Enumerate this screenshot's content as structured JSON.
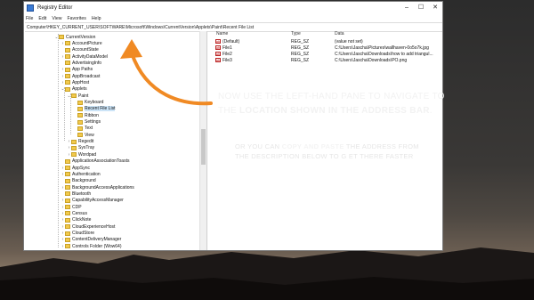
{
  "window": {
    "title": "Registry Editor",
    "controls": [
      "–",
      "☐",
      "✕"
    ]
  },
  "menu": [
    "File",
    "Edit",
    "View",
    "Favorites",
    "Help"
  ],
  "address": "Computer\\HKEY_CURRENT_USER\\SOFTWARE\\Microsoft\\Windows\\CurrentVersion\\Applets\\Paint\\Recent File List",
  "tree": [
    {
      "label": "CurrentVersion",
      "exp": "⌄"
    },
    {
      "label": "AccountPicture",
      "exp": "›"
    },
    {
      "label": "AccountState",
      "exp": ""
    },
    {
      "label": "ActivityDataModel",
      "exp": "›"
    },
    {
      "label": "AdvertisingInfo",
      "exp": ""
    },
    {
      "label": "App Paths",
      "exp": "›"
    },
    {
      "label": "AppBroadcast",
      "exp": "›"
    },
    {
      "label": "AppHost",
      "exp": "›"
    },
    {
      "label": "Applets",
      "exp": "⌄"
    },
    {
      "label": "Paint",
      "exp": "⌄"
    },
    {
      "label": "Keyboard",
      "exp": ""
    },
    {
      "label": "Recent File List",
      "exp": "",
      "selected": true
    },
    {
      "label": "Ribbon",
      "exp": ""
    },
    {
      "label": "Settings",
      "exp": ""
    },
    {
      "label": "Text",
      "exp": ""
    },
    {
      "label": "View",
      "exp": ""
    },
    {
      "label": "Regedit",
      "exp": "›"
    },
    {
      "label": "SysTray",
      "exp": "›"
    },
    {
      "label": "Wordpad",
      "exp": "›"
    },
    {
      "label": "ApplicationAssociationToasts",
      "exp": ""
    },
    {
      "label": "AppSync",
      "exp": "›"
    },
    {
      "label": "Authentication",
      "exp": "›"
    },
    {
      "label": "Background",
      "exp": ""
    },
    {
      "label": "BackgroundAccessApplications",
      "exp": "›"
    },
    {
      "label": "Bluetooth",
      "exp": ""
    },
    {
      "label": "CapabilityAccessManager",
      "exp": "›"
    },
    {
      "label": "CDP",
      "exp": "›"
    },
    {
      "label": "Census",
      "exp": "›"
    },
    {
      "label": "ClickNote",
      "exp": "›"
    },
    {
      "label": "CloudExperienceHost",
      "exp": "›"
    },
    {
      "label": "CloudStore",
      "exp": "›"
    },
    {
      "label": "ContentDeliveryManager",
      "exp": "›"
    },
    {
      "label": "Controls Folder (Wow64)",
      "exp": "›"
    }
  ],
  "columns": {
    "name": "Name",
    "type": "Type",
    "data": "Data"
  },
  "values": [
    {
      "name": "(Default)",
      "type": "REG_SZ",
      "data": "(value not set)"
    },
    {
      "name": "File1",
      "type": "REG_SZ",
      "data": "C:\\Users\\Jascha\\Pictures\\wallhaven-0o5o7k.jpg"
    },
    {
      "name": "File2",
      "type": "REG_SZ",
      "data": "C:\\Users\\Jascha\\Downloads\\how to add triangul..."
    },
    {
      "name": "File3",
      "type": "REG_SZ",
      "data": "C:\\Users\\Jascha\\Downloads\\PO.png"
    }
  ],
  "overlay": {
    "line1_pre": "NOW USE THE LEFT-HAND PANE TO NAVIGATE TO",
    "line2_pre": "THE ",
    "line2_bold": "LOCATION SHOWN IN THE ADDRESS BAR",
    "line2_post": ".",
    "line3_pre": "OR YOU CAN ",
    "line3_bold": "COPY AND PASTE",
    "line3_post": " THE ADDRESS FROM",
    "line4": "THE DESCRIPTION BELOW TO G ET THERE FASTER"
  },
  "colors": {
    "arrow": "#f08a24",
    "selection": "#cce4f7",
    "folder": "#f2c94c"
  }
}
